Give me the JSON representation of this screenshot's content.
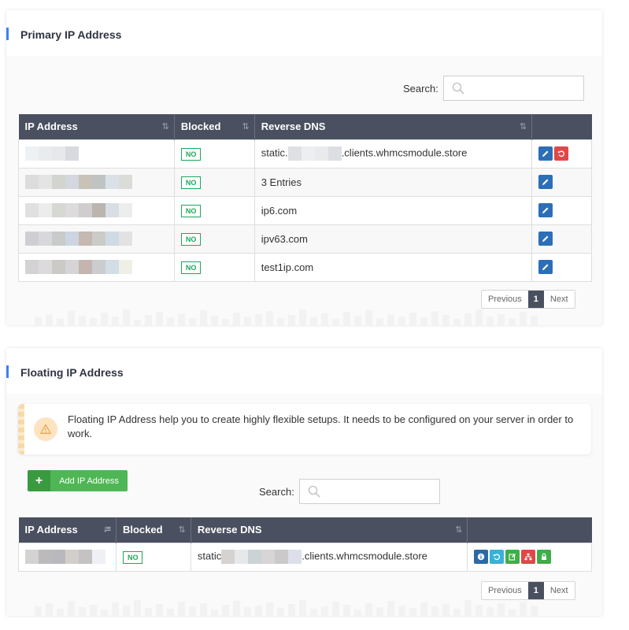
{
  "primary": {
    "title": "Primary IP Address",
    "search_label": "Search:",
    "search_value": "",
    "columns": [
      "IP Address",
      "Blocked",
      "Reverse DNS",
      ""
    ],
    "rows": [
      {
        "blocked": "NO",
        "rdns_prefix": "static.",
        "rdns_suffix": ".clients.whmcsmodule.store",
        "actions": [
          "edit",
          "reset"
        ]
      },
      {
        "blocked": "NO",
        "rdns_prefix": "3 Entries",
        "rdns_suffix": "",
        "actions": [
          "edit"
        ]
      },
      {
        "blocked": "NO",
        "rdns_prefix": "ip6.com",
        "rdns_suffix": "",
        "actions": [
          "edit"
        ]
      },
      {
        "blocked": "NO",
        "rdns_prefix": "ipv63.com",
        "rdns_suffix": "",
        "actions": [
          "edit"
        ]
      },
      {
        "blocked": "NO",
        "rdns_prefix": "test1ip.com",
        "rdns_suffix": "",
        "actions": [
          "edit"
        ]
      }
    ],
    "pagination": {
      "previous": "Previous",
      "current": "1",
      "next": "Next"
    }
  },
  "floating": {
    "title": "Floating IP Address",
    "notice": "Floating IP Address help you to create highly flexible setups. It needs to be configured on your server in order to work.",
    "add_button": "Add IP Address",
    "search_label": "Search:",
    "search_value": "",
    "columns": [
      "IP Address",
      "Blocked",
      "Reverse DNS",
      ""
    ],
    "rows": [
      {
        "blocked": "NO",
        "rdns_prefix": "static",
        "rdns_suffix": ".clients.whmcsmodule.store",
        "actions": [
          "info",
          "reset",
          "edit-note",
          "network",
          "lock"
        ]
      }
    ],
    "pagination": {
      "previous": "Previous",
      "current": "1",
      "next": "Next"
    }
  },
  "colors": {
    "accent": "#3b82f6",
    "table_header": "#4a5060",
    "badge_green": "#1ea65a",
    "btn_blue": "#2c6fb7",
    "btn_red": "#e04848",
    "add_green": "#4fb655"
  }
}
